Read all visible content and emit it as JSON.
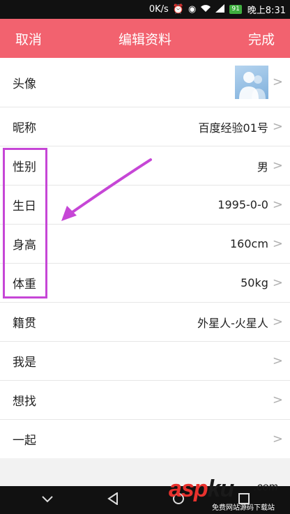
{
  "status_bar": {
    "speed": "0K/s",
    "alarm_icon": "alarm-icon",
    "eye_icon": "eye-icon",
    "wifi_icon": "wifi-icon",
    "signal_icon": "signal-icon",
    "battery": "91",
    "time": "晚上8:31"
  },
  "header": {
    "cancel": "取消",
    "title": "编辑资料",
    "done": "完成",
    "color": "#f2626f"
  },
  "rows": [
    {
      "label": "头像",
      "value": ""
    },
    {
      "label": "昵称",
      "value": "百度经验01号"
    },
    {
      "label": "性别",
      "value": "男"
    },
    {
      "label": "生日",
      "value": "1995-0-0"
    },
    {
      "label": "身高",
      "value": "160cm"
    },
    {
      "label": "体重",
      "value": "50kg"
    },
    {
      "label": "籍贯",
      "value": "外星人-火星人"
    },
    {
      "label": "我是",
      "value": ""
    },
    {
      "label": "想找",
      "value": ""
    },
    {
      "label": "一起",
      "value": ""
    }
  ],
  "annotation_color": "#c646d6",
  "watermark": {
    "asp": "asp",
    "ku": "ku",
    "dot": ".com",
    "subtitle": "免费网站源码下载站"
  }
}
